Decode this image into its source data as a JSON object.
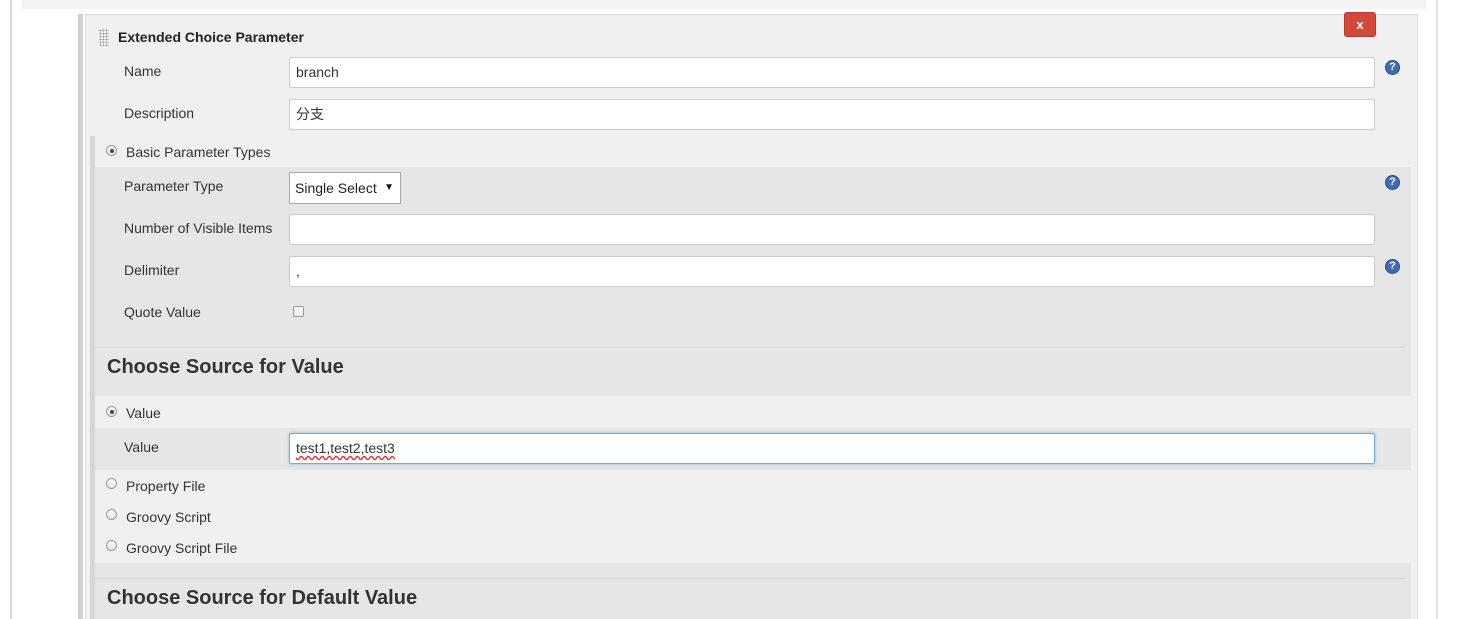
{
  "panel": {
    "title": "Extended Choice Parameter",
    "close_label": "x"
  },
  "fields": {
    "name_label": "Name",
    "name_value": "branch",
    "description_label": "Description",
    "description_value": "分支"
  },
  "basic_types": {
    "radio_label": "Basic Parameter Types",
    "parameter_type_label": "Parameter Type",
    "parameter_type_value": "Single Select",
    "visible_items_label": "Number of Visible Items",
    "visible_items_value": "",
    "delimiter_label": "Delimiter",
    "delimiter_value": ",",
    "quote_value_label": "Quote Value"
  },
  "value_source": {
    "heading": "Choose Source for Value",
    "options": [
      "Value",
      "Property File",
      "Groovy Script",
      "Groovy Script File"
    ],
    "value_label": "Value",
    "value_value": "test1,test2,test3"
  },
  "default_source": {
    "heading": "Choose Source for Default Value"
  },
  "icons": {
    "help": "help-icon",
    "drag": "drag-handle-icon",
    "dropdown": "chevron-down-icon"
  },
  "colors": {
    "close_button": "#d24939",
    "help_icon": "#3b6db5",
    "focus_border": "#66afe9"
  }
}
